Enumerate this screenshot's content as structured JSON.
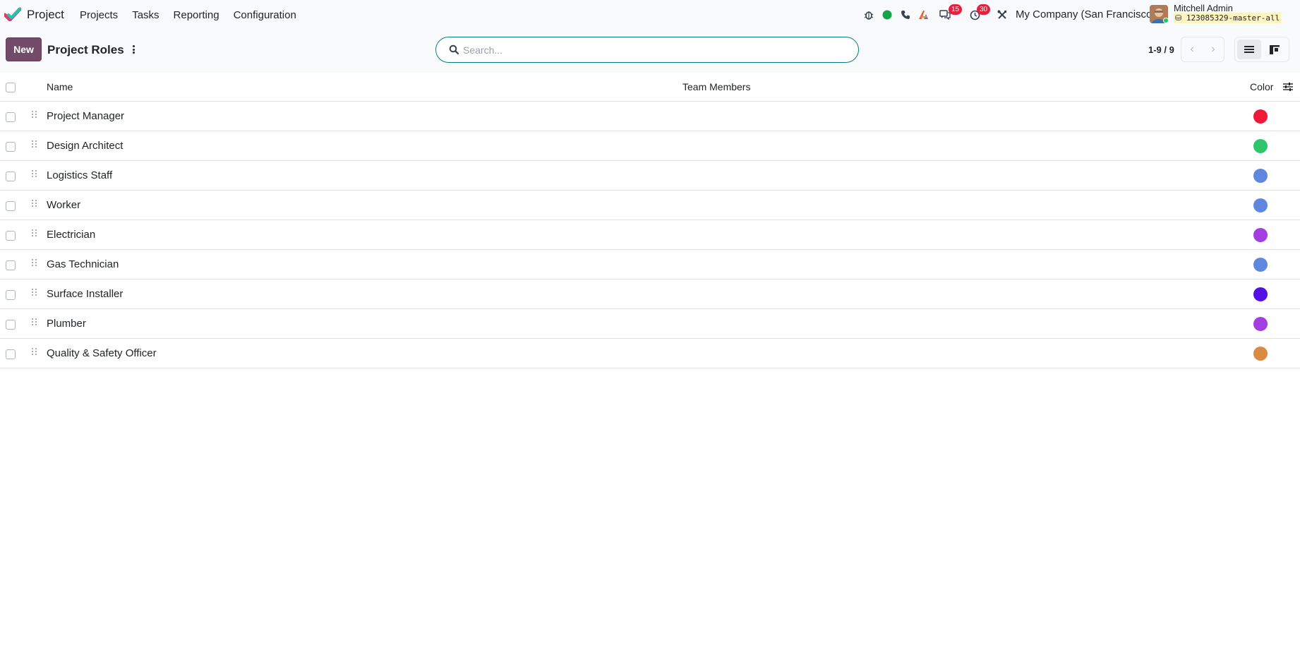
{
  "navbar": {
    "app_name": "Project",
    "menu": [
      "Projects",
      "Tasks",
      "Reporting",
      "Configuration"
    ],
    "messages_badge": "15",
    "activities_badge": "30",
    "company": "My Company (San Francisco)",
    "user_name": "Mitchell Admin",
    "database": "123085329-master-all",
    "presence_color": "#16a34a"
  },
  "control": {
    "new_label": "New",
    "title": "Project Roles",
    "search_placeholder": "Search...",
    "pager": "1-9 / 9"
  },
  "table": {
    "headers": {
      "name": "Name",
      "team": "Team Members",
      "color": "Color"
    },
    "rows": [
      {
        "name": "Project Manager",
        "team": "",
        "color": "#ee1a38"
      },
      {
        "name": "Design Architect",
        "team": "",
        "color": "#2ec66a"
      },
      {
        "name": "Logistics Staff",
        "team": "",
        "color": "#5d88dd"
      },
      {
        "name": "Worker",
        "team": "",
        "color": "#5d88dd"
      },
      {
        "name": "Electrician",
        "team": "",
        "color": "#a33ee0"
      },
      {
        "name": "Gas Technician",
        "team": "",
        "color": "#5d88dd"
      },
      {
        "name": "Surface Installer",
        "team": "",
        "color": "#5210e6"
      },
      {
        "name": "Plumber",
        "team": "",
        "color": "#a33ee0"
      },
      {
        "name": "Quality & Safety Officer",
        "team": "",
        "color": "#d98a43"
      }
    ]
  }
}
